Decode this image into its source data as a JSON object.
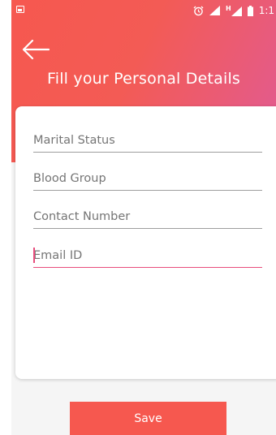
{
  "status_bar": {
    "time": "1:1",
    "icons": [
      "notification-icon",
      "alarm-icon",
      "signal-icon",
      "network-h-icon",
      "battery-icon"
    ]
  },
  "header": {
    "title": "Fill your Personal Details",
    "back_icon": "back-arrow-icon"
  },
  "form": {
    "fields": [
      {
        "placeholder": "Marital Status",
        "value": ""
      },
      {
        "placeholder": "Blood Group",
        "value": ""
      },
      {
        "placeholder": "Contact Number",
        "value": ""
      },
      {
        "placeholder": "Email ID",
        "value": ""
      }
    ],
    "focused_field": "Email ID"
  },
  "actions": {
    "save_label": "Save"
  },
  "colors": {
    "primary": "#f6584f",
    "gradient_end": "#e05b94",
    "focus_underline": "#e84d7c",
    "underline": "#9e9e9e"
  }
}
